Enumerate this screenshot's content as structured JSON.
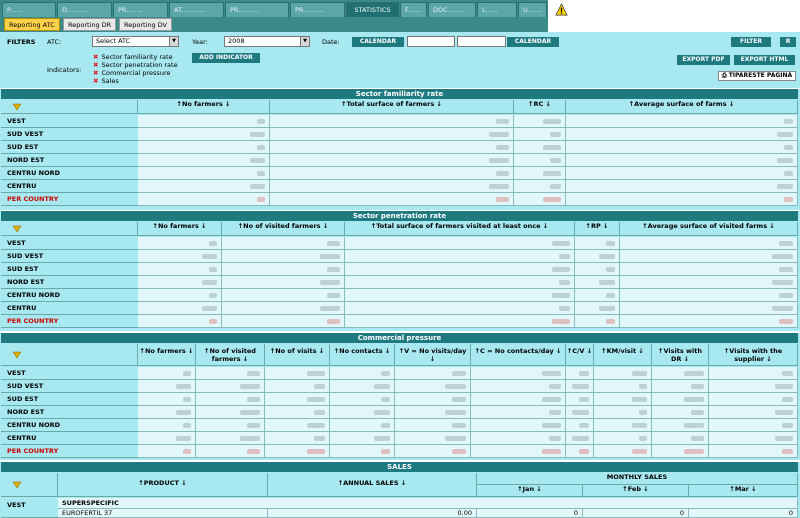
{
  "nav": {
    "tabs": [
      "P......",
      "D..........",
      "PR........",
      "AT............",
      "PR..........",
      "STATISTICS",
      "F.......",
      "DOC........",
      "L......",
      "U......."
    ],
    "active_tab": "STATISTICS"
  },
  "reports": [
    "Reporting ATC",
    "Reporting DR",
    "Reporting DV"
  ],
  "filters": {
    "label": "FILTERS",
    "atc_label": "ATC:",
    "atc_value": "Select ATC",
    "year_label": "Year:",
    "year_value": "2008",
    "date_label": "Date:",
    "calendar_label": "CALENDAR",
    "filter_button": "FILTER",
    "r_button": "R",
    "indicators_label": "Indicators:",
    "indicators": [
      "Sector familiarity rate",
      "Sector penetration rate",
      "Commercial pressure",
      "Sales"
    ],
    "add_indicator": "ADD INDICATOR",
    "export_pdf": "EXPORT PDF",
    "export_html": "EXPORT HTML",
    "print": "TIPARESTE PAGINA"
  },
  "regions": [
    "VEST",
    "SUD VEST",
    "SUD EST",
    "NORD EST",
    "CENTRU NORD",
    "CENTRU",
    "PER COUNTRY"
  ],
  "familiarity": {
    "title": "Sector familiarity rate",
    "columns": [
      "No farmers",
      "Total surface of farmers",
      "RC",
      "Average surface of farms"
    ]
  },
  "penetration": {
    "title": "Sector penetration rate",
    "columns": [
      "No farmers",
      "No of visited farmers",
      "Total surface of farmers visited at least once",
      "RP",
      "Average surface of visited farms"
    ]
  },
  "pressure": {
    "title": "Commercial pressure",
    "columns": [
      "No farmers",
      "No of visited farmers",
      "No of visits",
      "No contacts",
      "V = No visits/day",
      "C = No contacts/day",
      "C/V",
      "KM/visit",
      "Visits with DR",
      "Visits with the supplier"
    ]
  },
  "sales": {
    "title": "SALES",
    "product_col": "PRODUCT",
    "annual_col": "ANNUAL SALES",
    "monthly_col": "MONTHLY SALES",
    "months": [
      "Jan",
      "Feb",
      "Mar"
    ],
    "region": "VEST",
    "group": "SUPERSPECIFIC",
    "product": "EUROFERTIL 37",
    "annual": "0.00",
    "jan": "0",
    "feb": "0",
    "mar": "0"
  },
  "colors": {
    "header": "#1f7a80",
    "panel": "#a8e8f0",
    "cell": "#e2f7fa",
    "per_country": "#cc0000"
  }
}
